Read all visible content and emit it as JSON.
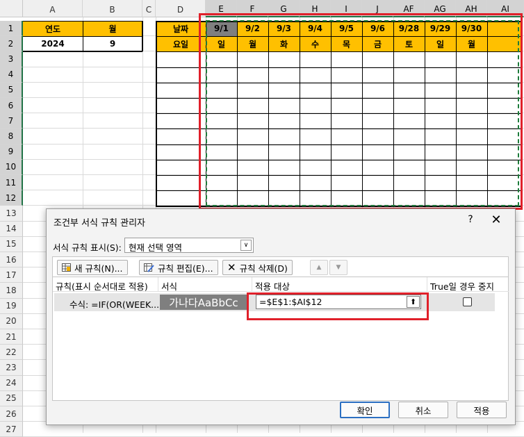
{
  "spreadsheet": {
    "columns": [
      "A",
      "B",
      "C",
      "D",
      "E",
      "F",
      "G",
      "H",
      "I",
      "J",
      "AF",
      "AG",
      "AH",
      "AI"
    ],
    "rows": [
      "1",
      "2",
      "3",
      "4",
      "5",
      "6",
      "7",
      "8",
      "9",
      "10",
      "11",
      "12",
      "13",
      "14",
      "15",
      "16",
      "17",
      "18",
      "19",
      "20",
      "21",
      "22",
      "23",
      "24",
      "25",
      "26",
      "27"
    ],
    "a1": "연도",
    "b1": "월",
    "a2": "2024",
    "b2": "9",
    "d1": "날짜",
    "d2": "요일",
    "dates": [
      "9/1",
      "9/2",
      "9/3",
      "9/4",
      "9/5",
      "9/6",
      "9/28",
      "9/29",
      "9/30"
    ],
    "weekdays": [
      "일",
      "월",
      "화",
      "수",
      "목",
      "금",
      "토",
      "일",
      "월"
    ],
    "header_fill_color": "#ffc000",
    "selection_color": "#1f7a3a",
    "highlight_color": "#e0202a"
  },
  "dialog": {
    "title": "조건부 서식 규칙 관리자",
    "help": "?",
    "close": "✕",
    "show_rules_label": "서식 규칙 표시(S):",
    "show_rules_value": "현재 선택 영역",
    "new_rule": "새 규칙(N)...",
    "edit_rule": "규칙 편집(E)...",
    "delete_rule": "규칙 삭제(D)",
    "col_rule": "규칙(표시 순서대로 적용)",
    "col_format": "서식",
    "col_applies": "적용 대상",
    "col_stop": "True일 경우 중지",
    "rule_formula": "수식: =IF(OR(WEEK...",
    "preview_text": "가나다AaBbCc",
    "applies_to": "=$E$1:$AI$12",
    "stop_if_true": false,
    "ok": "확인",
    "cancel": "취소",
    "apply": "적용"
  }
}
